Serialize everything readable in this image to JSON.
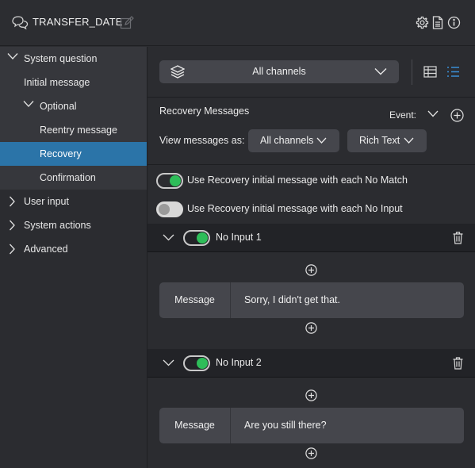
{
  "header": {
    "title": "TRANSFER_DATE",
    "icons": [
      "chat-bubbles-icon",
      "edit-icon",
      "gear-icon",
      "document-icon",
      "info-icon"
    ]
  },
  "sidebar": {
    "items": [
      {
        "label": "System question",
        "type": "group",
        "expanded": true
      },
      {
        "label": "Initial message",
        "type": "item"
      },
      {
        "label": "Optional",
        "type": "subgroup",
        "expanded": true
      },
      {
        "label": "Reentry message",
        "type": "item"
      },
      {
        "label": "Recovery",
        "type": "item",
        "active": true
      },
      {
        "label": "Confirmation",
        "type": "item"
      },
      {
        "label": "User input",
        "type": "group",
        "expanded": false
      },
      {
        "label": "System actions",
        "type": "group",
        "expanded": false
      },
      {
        "label": "Advanced",
        "type": "group",
        "expanded": false
      }
    ]
  },
  "toolbar": {
    "channel_select": "All channels"
  },
  "recovery": {
    "title": "Recovery Messages",
    "event_label": "Event:",
    "view_as_label": "View messages as:",
    "view_channel": "All channels",
    "view_format": "Rich Text"
  },
  "options": [
    {
      "label": "Use Recovery initial message with each No Match",
      "enabled": true
    },
    {
      "label": "Use Recovery initial message with each No Input",
      "enabled": false
    }
  ],
  "inputs": [
    {
      "label": "No Input 1",
      "enabled": true,
      "message_label": "Message",
      "message": "Sorry, I didn't get that."
    },
    {
      "label": "No Input 2",
      "enabled": true,
      "message_label": "Message",
      "message": "Are you still there?"
    }
  ],
  "colors": {
    "accent": "#2b74a8",
    "toggle_on": "#2ebd59",
    "background": "#2b2c30",
    "card": "#45464c"
  }
}
